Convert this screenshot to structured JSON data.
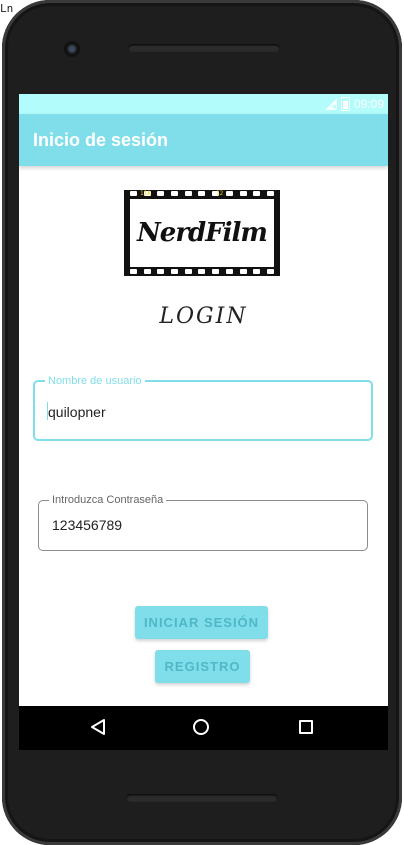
{
  "corner_text": "Ln",
  "statusbar": {
    "time": "09:09"
  },
  "appbar": {
    "title": "Inicio de sesión"
  },
  "logo": {
    "text": "NerdFilm",
    "frame_num_left": "11A",
    "frame_num_right": "12"
  },
  "heading": {
    "text": "LOGIN"
  },
  "username_field": {
    "label": "Nombre de usuario",
    "value": "quilopner"
  },
  "password_field": {
    "label": "Introduzca Contraseña",
    "value": "123456789"
  },
  "buttons": {
    "login": "INICIAR SESIÓN",
    "register": "REGISTRO"
  },
  "colors": {
    "statusbar": "#b2fcfc",
    "appbar": "#80deea",
    "accent": "#80deea",
    "button_text": "#4fb7c6"
  },
  "icons": {
    "nav_back": "back-triangle-icon",
    "nav_home": "home-circle-icon",
    "nav_recents": "recents-square-icon"
  }
}
